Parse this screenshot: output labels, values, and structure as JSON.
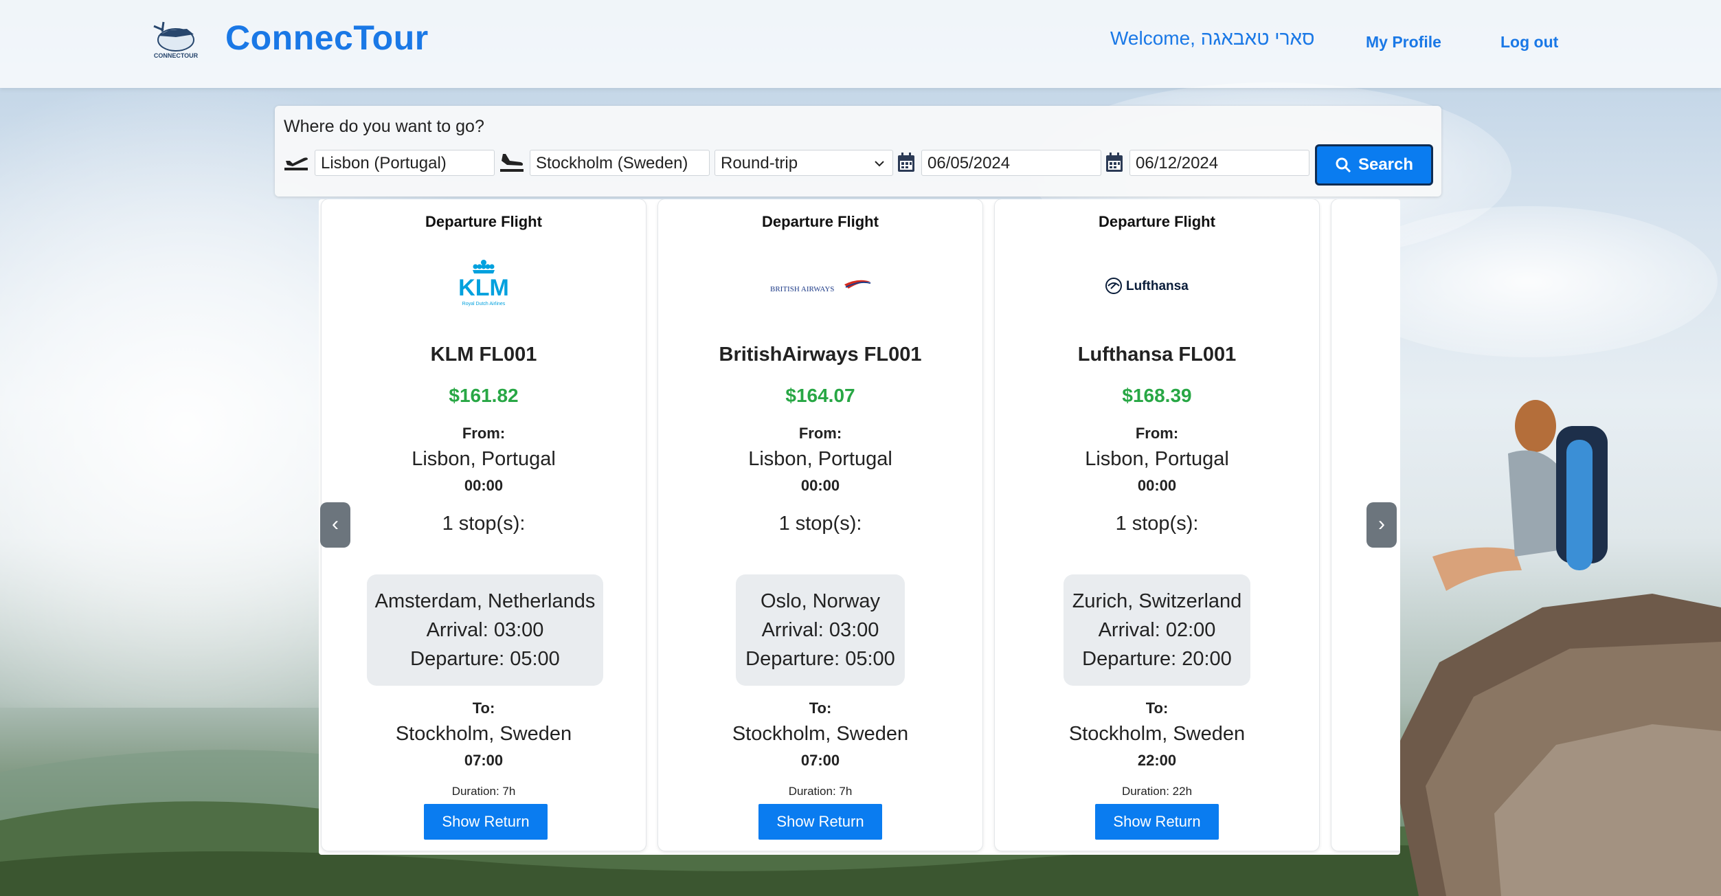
{
  "header": {
    "brand": "ConnecTour",
    "logo_text": "CONNECTOUR",
    "welcome": "Welcome, סארי טאבאגה",
    "my_profile": "My Profile",
    "log_out": "Log out"
  },
  "search": {
    "prompt": "Where do you want to go?",
    "from": "Lisbon (Portugal)",
    "to": "Stockholm (Sweden)",
    "trip_type": "Round-trip",
    "depart_date": "06/05/2024",
    "return_date": "06/12/2024",
    "search_label": "Search"
  },
  "carousel": {
    "prev": "‹",
    "next": "›",
    "cards": [
      {
        "heading": "Departure Flight",
        "logo": "klm-logo",
        "logo_text": "KLM",
        "logo_sub": "Royal Dutch Airlines",
        "flight": "KLM FL001",
        "price": "$161.82",
        "from_label": "From:",
        "from_city": "Lisbon, Portugal",
        "from_time": "00:00",
        "stops": "1 stop(s):",
        "stop_city": "Amsterdam, Netherlands",
        "stop_arrival": "Arrival: 03:00",
        "stop_departure": "Departure: 05:00",
        "to_label": "To:",
        "to_city": "Stockholm, Sweden",
        "to_time": "07:00",
        "duration": "Duration: 7h",
        "button": "Show Return"
      },
      {
        "heading": "Departure Flight",
        "logo": "british-airways-logo",
        "logo_text": "BRITISH AIRWAYS",
        "flight": "BritishAirways FL001",
        "price": "$164.07",
        "from_label": "From:",
        "from_city": "Lisbon, Portugal",
        "from_time": "00:00",
        "stops": "1 stop(s):",
        "stop_city": "Oslo, Norway",
        "stop_arrival": "Arrival: 03:00",
        "stop_departure": "Departure: 05:00",
        "to_label": "To:",
        "to_city": "Stockholm, Sweden",
        "to_time": "07:00",
        "duration": "Duration: 7h",
        "button": "Show Return"
      },
      {
        "heading": "Departure Flight",
        "logo": "lufthansa-logo",
        "logo_text": "Lufthansa",
        "flight": "Lufthansa FL001",
        "price": "$168.39",
        "from_label": "From:",
        "from_city": "Lisbon, Portugal",
        "from_time": "00:00",
        "stops": "1 stop(s):",
        "stop_city": "Zurich, Switzerland",
        "stop_arrival": "Arrival: 02:00",
        "stop_departure": "Departure: 20:00",
        "to_label": "To:",
        "to_city": "Stockholm, Sweden",
        "to_time": "22:00",
        "duration": "Duration: 22h",
        "button": "Show Return"
      }
    ]
  },
  "colors": {
    "brand_blue": "#1a78e6",
    "button_blue": "#0a7cf0",
    "price_green": "#28a745",
    "stop_box": "#e9ecef",
    "arrow_gray": "#6c757d"
  }
}
